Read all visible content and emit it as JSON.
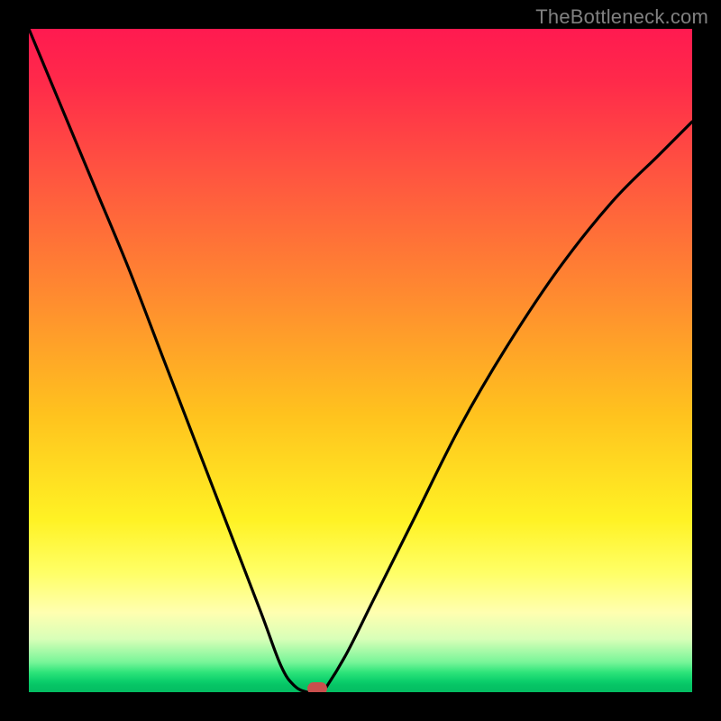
{
  "watermark": "TheBottleneck.com",
  "chart_data": {
    "type": "line",
    "title": "",
    "xlabel": "",
    "ylabel": "",
    "xlim": [
      0,
      100
    ],
    "ylim": [
      0,
      100
    ],
    "grid": false,
    "legend": false,
    "series": [
      {
        "name": "curve",
        "x": [
          0,
          5,
          10,
          15,
          20,
          25,
          30,
          35,
          38,
          40,
          42,
          44,
          45,
          48,
          52,
          58,
          65,
          72,
          80,
          88,
          95,
          100
        ],
        "y": [
          100,
          88,
          76,
          64,
          51,
          38,
          25,
          12,
          4,
          1,
          0,
          0,
          1,
          6,
          14,
          26,
          40,
          52,
          64,
          74,
          81,
          86
        ]
      }
    ],
    "marker": {
      "x": 43.5,
      "y": 0.6
    },
    "background_gradient": {
      "top": "#ff1a50",
      "upper_mid": "#ffa028",
      "mid": "#ffff40",
      "lower_mid": "#d8ffb8",
      "bottom": "#04bd62"
    }
  }
}
